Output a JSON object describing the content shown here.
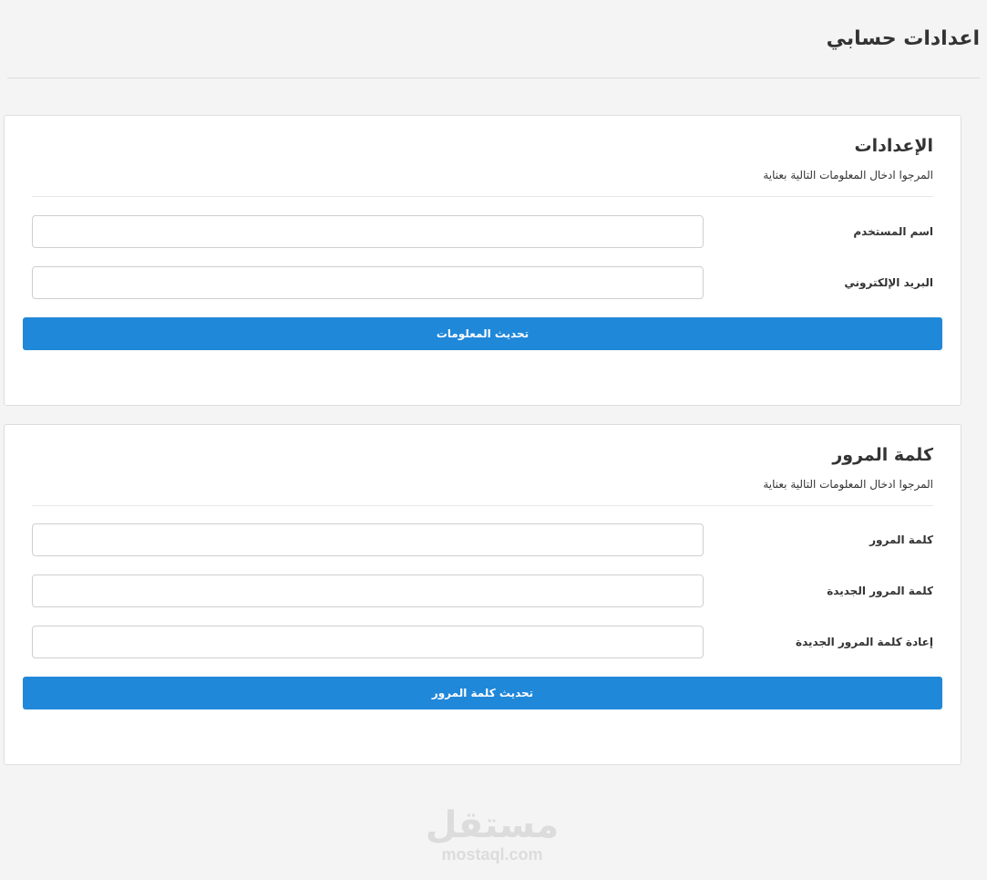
{
  "page": {
    "title": "اعدادات حسابي"
  },
  "settings_card": {
    "title": "الإعدادات",
    "subtitle": "المرجوا ادخال المعلومات التالية بعناية",
    "fields": [
      {
        "label": "اسم المستخدم",
        "value": "",
        "placeholder": ""
      },
      {
        "label": "البريد الإلكتروني",
        "value": "",
        "placeholder": ""
      }
    ],
    "button_label": "تحديث المعلومات"
  },
  "password_card": {
    "title": "كلمة المرور",
    "subtitle": "المرجوا ادخال المعلومات التالية بعناية",
    "fields": [
      {
        "label": "كلمة المرور",
        "value": "",
        "placeholder": ""
      },
      {
        "label": "كلمة المرور الجديدة",
        "value": "",
        "placeholder": ""
      },
      {
        "label": "إعادة كلمة المرور الجديدة",
        "value": "",
        "placeholder": ""
      }
    ],
    "button_label": "تحديث كلمة المرور"
  },
  "watermark": {
    "logo_text": "مستقل",
    "domain": "mostaql.com"
  },
  "colors": {
    "background": "#f4f4f4",
    "card_background": "#ffffff",
    "primary_button": "#2088d9",
    "text": "#333333"
  }
}
